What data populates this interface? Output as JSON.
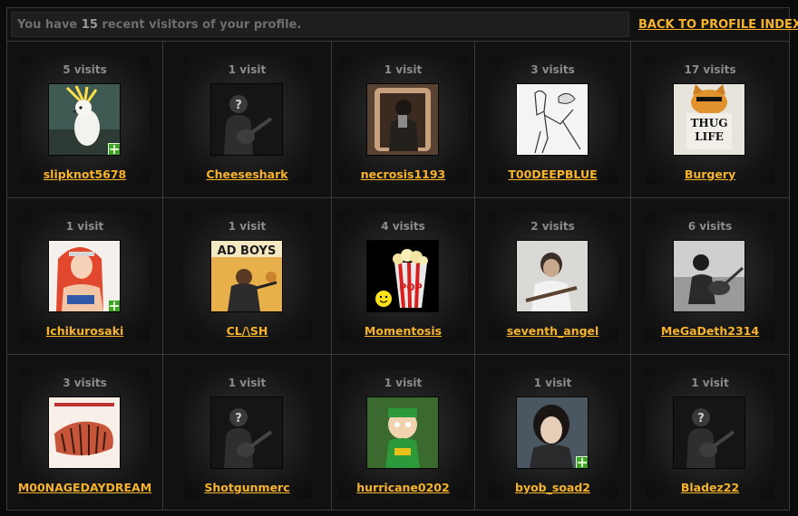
{
  "header": {
    "visitors_prefix": "You have",
    "visitors_count": "15",
    "visitors_suffix": "recent visitors of your profile.",
    "back_link": "BACK TO PROFILE INDEX"
  },
  "colors": {
    "link": "#f6b32b",
    "online_badge": "#3fa32a",
    "background": "#0b0b0b"
  },
  "visitors": [
    {
      "visits": "5 visits",
      "name": "slipknot5678",
      "avatar": "cockatoo",
      "online": true
    },
    {
      "visits": "1 visit",
      "name": "Cheeseshark",
      "avatar": "default-guitar-silhouette",
      "online": false
    },
    {
      "visits": "1 visit",
      "name": "necrosis1193",
      "avatar": "mirror-selfie",
      "online": false
    },
    {
      "visits": "3 visits",
      "name": "T00DEEPBLUE",
      "avatar": "sketch-drawing",
      "online": false
    },
    {
      "visits": "17 visits",
      "name": "Burgery",
      "avatar": "thug-life-cat",
      "online": false,
      "avatar_text": "THUG LIFE"
    },
    {
      "visits": "1 visit",
      "name": "Ichikurosaki",
      "avatar": "anime-character",
      "online": true
    },
    {
      "visits": "1 visit",
      "name": "CL/\\SH",
      "avatar": "bad-boys-poster",
      "online": false,
      "avatar_text": "AD BOYS"
    },
    {
      "visits": "4 visits",
      "name": "Momentosis",
      "avatar": "popcorn-smiley",
      "online": false,
      "avatar_text": "POP"
    },
    {
      "visits": "2 visits",
      "name": "seventh_angel",
      "avatar": "boy-with-guitar",
      "online": false
    },
    {
      "visits": "6 visits",
      "name": "MeGaDeth2314",
      "avatar": "guitarist-bw",
      "online": false
    },
    {
      "visits": "3 visits",
      "name": "M00NAGEDAYDREAM",
      "avatar": "tiger-drawing",
      "online": false
    },
    {
      "visits": "1 visit",
      "name": "Shotgunmerc",
      "avatar": "default-guitar-silhouette",
      "online": false
    },
    {
      "visits": "1 visit",
      "name": "hurricane0202",
      "avatar": "cartoon-character",
      "online": false
    },
    {
      "visits": "1 visit",
      "name": "byob_soad2",
      "avatar": "dark-hair-portrait",
      "online": true
    },
    {
      "visits": "1 visit",
      "name": "Bladez22",
      "avatar": "default-guitar-silhouette",
      "online": false
    }
  ]
}
